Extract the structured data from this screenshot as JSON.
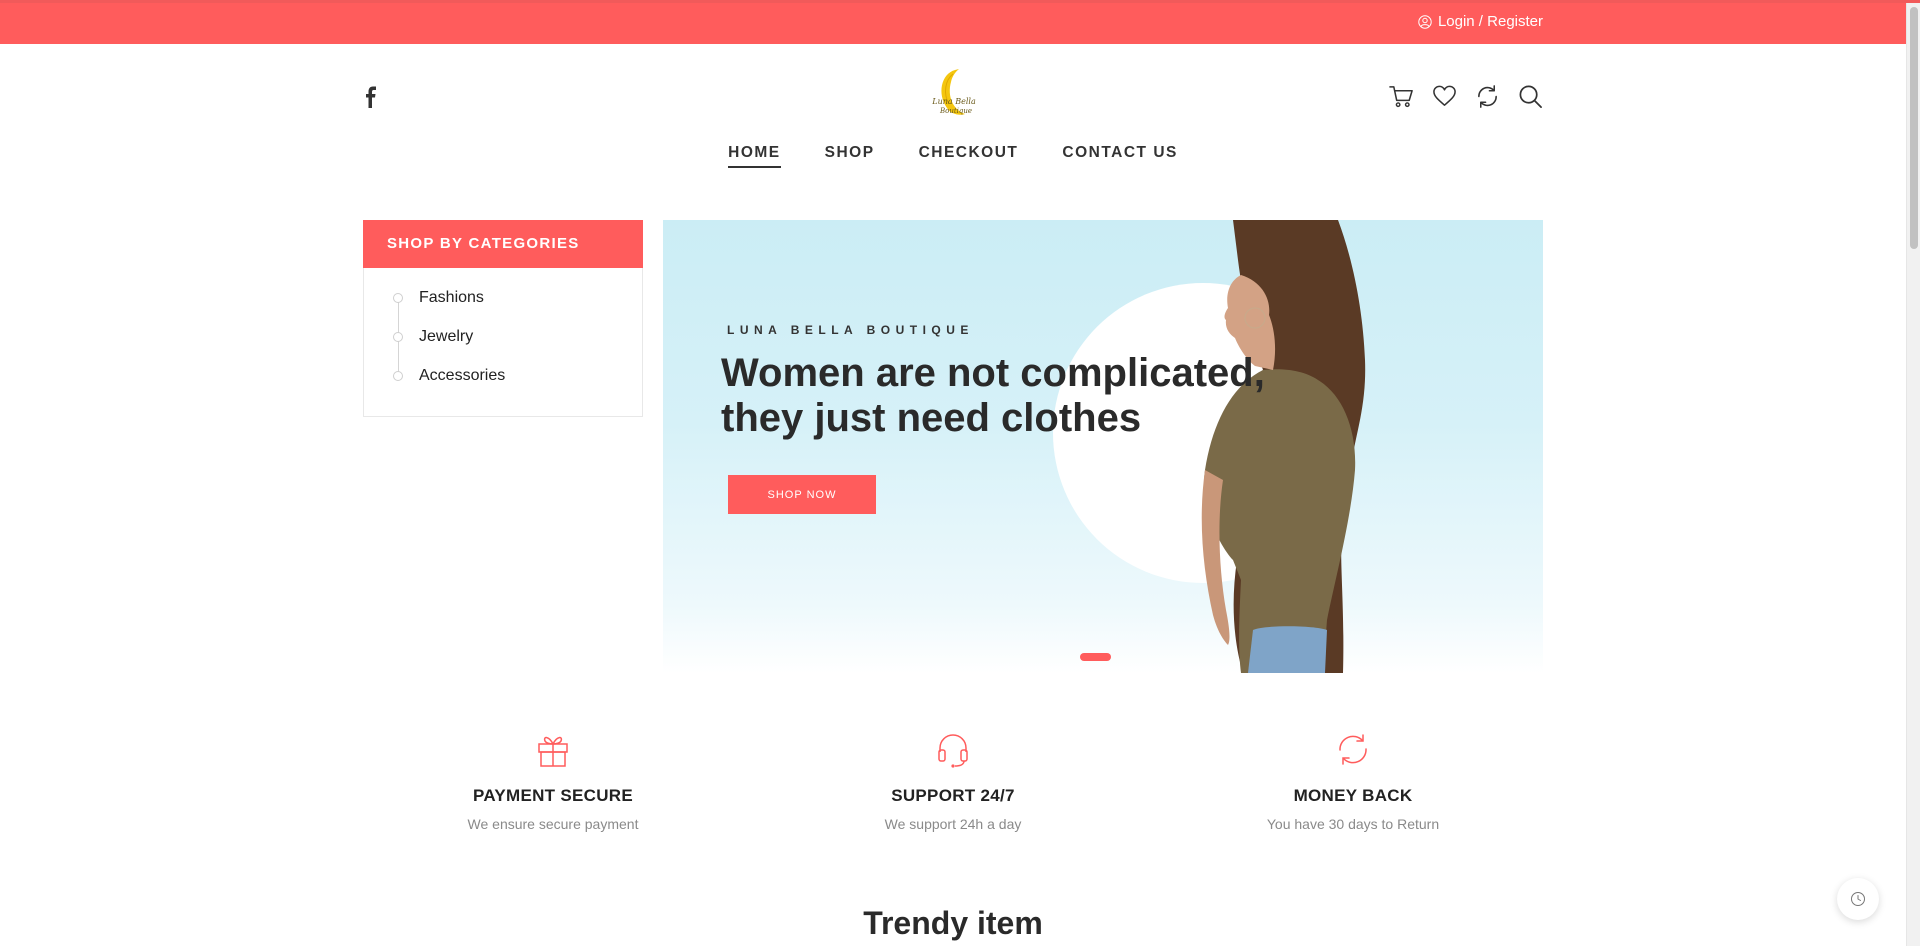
{
  "topbar": {
    "login_label": "Login / Register",
    "accent_color": "#ff5c5c"
  },
  "header": {
    "logo_text_line1": "Luna Bella",
    "logo_text_line2": "Boutique",
    "social": [
      "facebook-icon"
    ],
    "icons": [
      "cart-icon",
      "heart-icon",
      "compare-icon",
      "search-icon"
    ]
  },
  "nav": {
    "items": [
      {
        "label": "HOME",
        "active": true
      },
      {
        "label": "SHOP",
        "active": false
      },
      {
        "label": "CHECKOUT",
        "active": false
      },
      {
        "label": "CONTACT US",
        "active": false
      }
    ]
  },
  "categories": {
    "title": "SHOP BY CATEGORIES",
    "items": [
      "Fashions",
      "Jewelry",
      "Accessories"
    ]
  },
  "hero": {
    "eyebrow": "LUNA BELLA BOUTIQUE",
    "title_line1": "Women are not complicated,",
    "title_line2": "they just need clothes",
    "button_label": "SHOP NOW"
  },
  "features": [
    {
      "icon": "gift-icon",
      "title": "PAYMENT SECURE",
      "subtitle": "We ensure secure payment"
    },
    {
      "icon": "headphones-icon",
      "title": "SUPPORT 24/7",
      "subtitle": "We support 24h a day"
    },
    {
      "icon": "refresh-icon",
      "title": "MONEY BACK",
      "subtitle": "You have 30 days to Return"
    }
  ],
  "section": {
    "trendy_title": "Trendy item"
  }
}
